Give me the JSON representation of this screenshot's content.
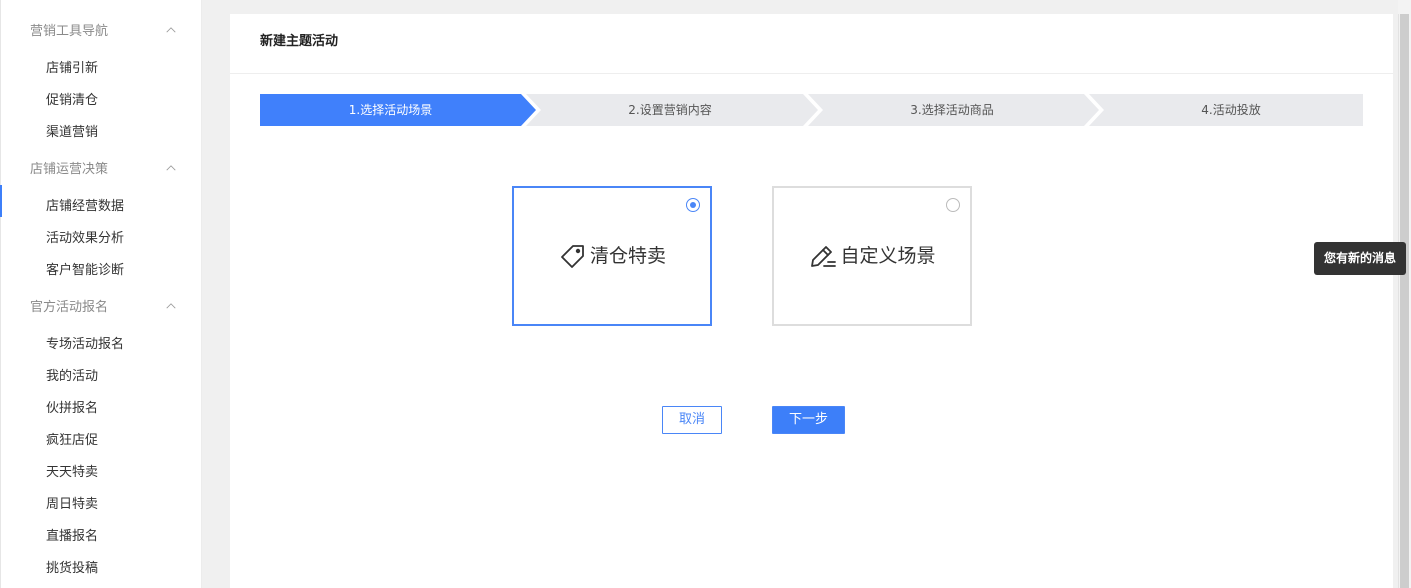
{
  "sidebar": {
    "groups": [
      {
        "title": "营销工具导航",
        "items": [
          "店铺引新",
          "促销清仓",
          "渠道营销"
        ]
      },
      {
        "title": "店铺运营决策",
        "items": [
          "店铺经营数据",
          "活动效果分析",
          "客户智能诊断"
        ]
      },
      {
        "title": "官方活动报名",
        "items": [
          "专场活动报名",
          "我的活动",
          "伙拼报名",
          "疯狂店促",
          "天天特卖",
          "周日特卖",
          "直播报名",
          "挑货投稿"
        ]
      }
    ]
  },
  "main": {
    "title": "新建主题活动",
    "steps": [
      {
        "label": "1.选择活动场景",
        "active": true
      },
      {
        "label": "2.设置营销内容",
        "active": false
      },
      {
        "label": "3.选择活动商品",
        "active": false
      },
      {
        "label": "4.活动投放",
        "active": false
      }
    ],
    "scenarios": [
      {
        "label": "清仓特卖",
        "icon": "price-tag-icon",
        "selected": true
      },
      {
        "label": "自定义场景",
        "icon": "edit-pen-icon",
        "selected": false
      }
    ],
    "cancel_label": "取消",
    "next_label": "下一步"
  },
  "toast": {
    "message": "您有新的消息"
  },
  "colors": {
    "accent": "#3d7ff9",
    "step_inactive": "#e9eaed",
    "text": "#333333",
    "muted": "#8a8a8a",
    "toast_bg": "#333333"
  }
}
